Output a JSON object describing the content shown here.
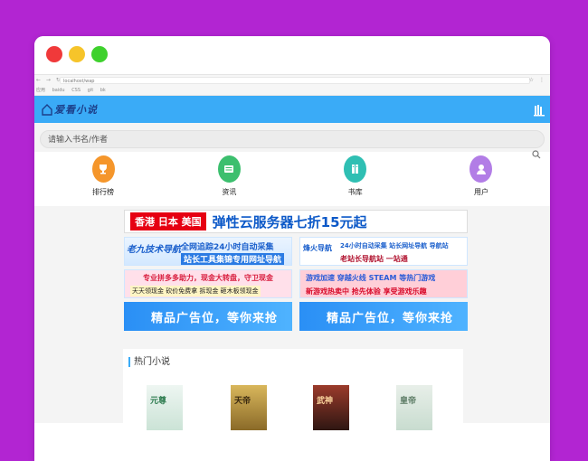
{
  "browser": {
    "nav_glyphs": "← → ↻",
    "url": "localhost/wap",
    "bookmarks": [
      "应用",
      "baidu",
      "CSS",
      "git",
      "bk"
    ]
  },
  "site": {
    "logo_text": "爱看小说"
  },
  "search": {
    "placeholder": "请输入书名/作者"
  },
  "nav": [
    {
      "label": "排行榜",
      "color": "#f5962b",
      "icon": "trophy-icon"
    },
    {
      "label": "资讯",
      "color": "#3cbf6e",
      "icon": "news-icon"
    },
    {
      "label": "书库",
      "color": "#2fbfb3",
      "icon": "books-icon"
    },
    {
      "label": "用户",
      "color": "#b27de6",
      "icon": "user-icon"
    }
  ],
  "ads": {
    "top_red": "香港 日本 美国",
    "top_blue": "弹性云服务器七折15元起",
    "a_logo": "老九技术导航",
    "a_line1": "全网追踪24小时自动采集",
    "a_line2": "站长工具集锦专用网址导航",
    "b_logo": "烽火导航",
    "b_line1": "24小时自动采集 站长网址导航 导航站",
    "b_line2": "老站长导航站 一站通",
    "c_line1": "专业拼多多助力，现金大转盘，守卫现金",
    "c_line2": "天天领现金  砍价免费拿  拆现金  砸木板领现金",
    "d_line1": "游戏加速  穿越火线  STEAM  等热门游戏",
    "d_line2": "新游戏热卖中 抢先体验 享受游戏乐趣",
    "promo": "精品广告位，等你来抢"
  },
  "hot": {
    "title": "热门小说",
    "books": [
      "元尊",
      "天帝",
      "武神",
      "皇帝"
    ]
  }
}
